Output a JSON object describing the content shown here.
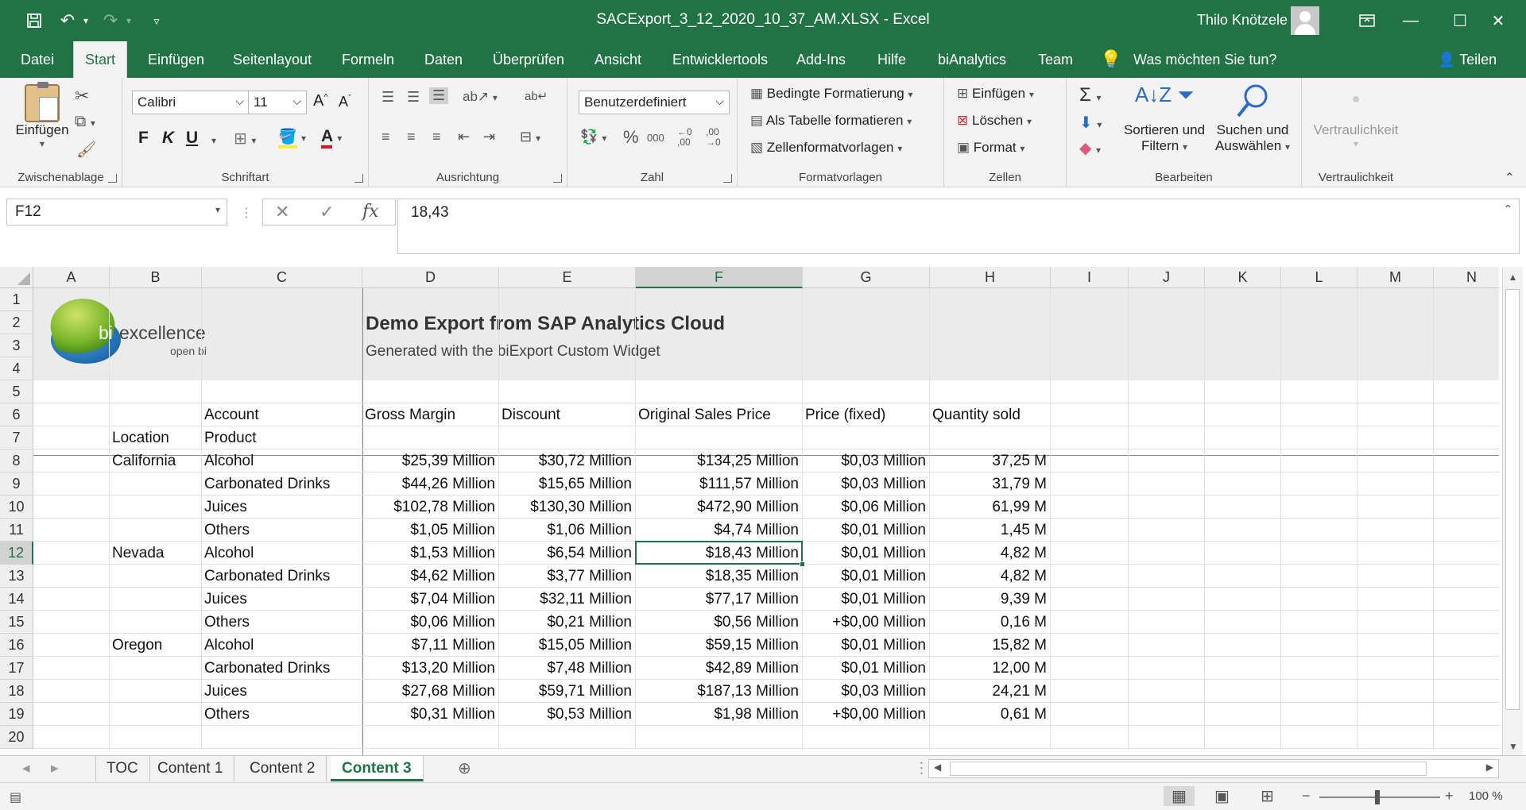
{
  "window": {
    "title": "SACExport_3_12_2020_10_37_AM.XLSX  -  Excel",
    "user": "Thilo Knötzele",
    "accent": "#217346"
  },
  "tabs": [
    "Datei",
    "Start",
    "Einfügen",
    "Seitenlayout",
    "Formeln",
    "Daten",
    "Überprüfen",
    "Ansicht",
    "Entwicklertools",
    "Add-Ins",
    "Hilfe",
    "biAnalytics",
    "Team"
  ],
  "tell_me": "Was möchten Sie tun?",
  "share": "Teilen",
  "ribbon": {
    "clipboard": {
      "paste": "Einfügen",
      "label": "Zwischenablage"
    },
    "font": {
      "name": "Calibri",
      "size": "11",
      "bold": "F",
      "italic": "K",
      "underline": "U",
      "label": "Schriftart"
    },
    "alignment": {
      "label": "Ausrichtung"
    },
    "number": {
      "format": "Benutzerdefiniert",
      "label": "Zahl"
    },
    "styles": {
      "conditional": "Bedingte Formatierung",
      "as_table": "Als Tabelle formatieren",
      "cell_styles": "Zellenformatvorlagen",
      "label": "Formatvorlagen"
    },
    "cells": {
      "insert": "Einfügen",
      "delete": "Löschen",
      "format": "Format",
      "label": "Zellen"
    },
    "editing": {
      "sort": "Sortieren und",
      "sort2": "Filtern",
      "find": "Suchen und",
      "find2": "Auswählen",
      "label": "Bearbeiten"
    },
    "sensitivity": {
      "button": "Vertraulichkeit",
      "label": "Vertraulichkeit"
    }
  },
  "formula_bar": {
    "name_box": "F12",
    "formula": "18,43"
  },
  "columns": [
    "A",
    "B",
    "C",
    "D",
    "E",
    "F",
    "G",
    "H",
    "I",
    "J",
    "K",
    "L",
    "M",
    "N"
  ],
  "rows": [
    "1",
    "2",
    "3",
    "4",
    "5",
    "6",
    "7",
    "8",
    "9",
    "10",
    "11",
    "12",
    "13",
    "14",
    "15",
    "16",
    "17",
    "18",
    "19",
    "20"
  ],
  "header": {
    "logo_text": "excellence",
    "logo_bi": "bi",
    "logo_sub": "open bi",
    "title": "Demo Export from SAP Analytics Cloud",
    "subtitle": "Generated with the biExport Custom Widget"
  },
  "table": {
    "account_label": "Account",
    "location_label": "Location",
    "product_label": "Product",
    "measures": [
      "Gross Margin",
      "Discount",
      "Original Sales Price",
      "Price (fixed)",
      "Quantity sold"
    ],
    "rows": [
      {
        "loc": "California",
        "prod": "Alcohol",
        "v": [
          "$25,39 Million",
          "$30,72 Million",
          "$134,25 Million",
          "$0,03 Million",
          "37,25 M"
        ]
      },
      {
        "loc": "",
        "prod": "Carbonated Drinks",
        "v": [
          "$44,26 Million",
          "$15,65 Million",
          "$111,57 Million",
          "$0,03 Million",
          "31,79 M"
        ]
      },
      {
        "loc": "",
        "prod": "Juices",
        "v": [
          "$102,78 Million",
          "$130,30 Million",
          "$472,90 Million",
          "$0,06 Million",
          "61,99 M"
        ]
      },
      {
        "loc": "",
        "prod": "Others",
        "v": [
          "$1,05 Million",
          "$1,06 Million",
          "$4,74 Million",
          "$0,01 Million",
          "1,45 M"
        ]
      },
      {
        "loc": "Nevada",
        "prod": "Alcohol",
        "v": [
          "$1,53 Million",
          "$6,54 Million",
          "$18,43 Million",
          "$0,01 Million",
          "4,82 M"
        ]
      },
      {
        "loc": "",
        "prod": "Carbonated Drinks",
        "v": [
          "$4,62 Million",
          "$3,77 Million",
          "$18,35 Million",
          "$0,01 Million",
          "4,82 M"
        ]
      },
      {
        "loc": "",
        "prod": "Juices",
        "v": [
          "$7,04 Million",
          "$32,11 Million",
          "$77,17 Million",
          "$0,01 Million",
          "9,39 M"
        ]
      },
      {
        "loc": "",
        "prod": "Others",
        "v": [
          "$0,06 Million",
          "$0,21 Million",
          "$0,56 Million",
          "+$0,00 Million",
          "0,16 M"
        ]
      },
      {
        "loc": "Oregon",
        "prod": "Alcohol",
        "v": [
          "$7,11 Million",
          "$15,05 Million",
          "$59,15 Million",
          "$0,01 Million",
          "15,82 M"
        ]
      },
      {
        "loc": "",
        "prod": "Carbonated Drinks",
        "v": [
          "$13,20 Million",
          "$7,48 Million",
          "$42,89 Million",
          "$0,01 Million",
          "12,00 M"
        ]
      },
      {
        "loc": "",
        "prod": "Juices",
        "v": [
          "$27,68 Million",
          "$59,71 Million",
          "$187,13 Million",
          "$0,03 Million",
          "24,21 M"
        ]
      },
      {
        "loc": "",
        "prod": "Others",
        "v": [
          "$0,31 Million",
          "$0,53 Million",
          "$1,98 Million",
          "+$0,00 Million",
          "0,61 M"
        ]
      }
    ]
  },
  "sheets": [
    "TOC",
    "Content 1",
    "Content 2",
    "Content 3"
  ],
  "active_sheet": "Content 3",
  "selected_cell": {
    "col": "F",
    "row": "12"
  },
  "zoom": "100 %"
}
